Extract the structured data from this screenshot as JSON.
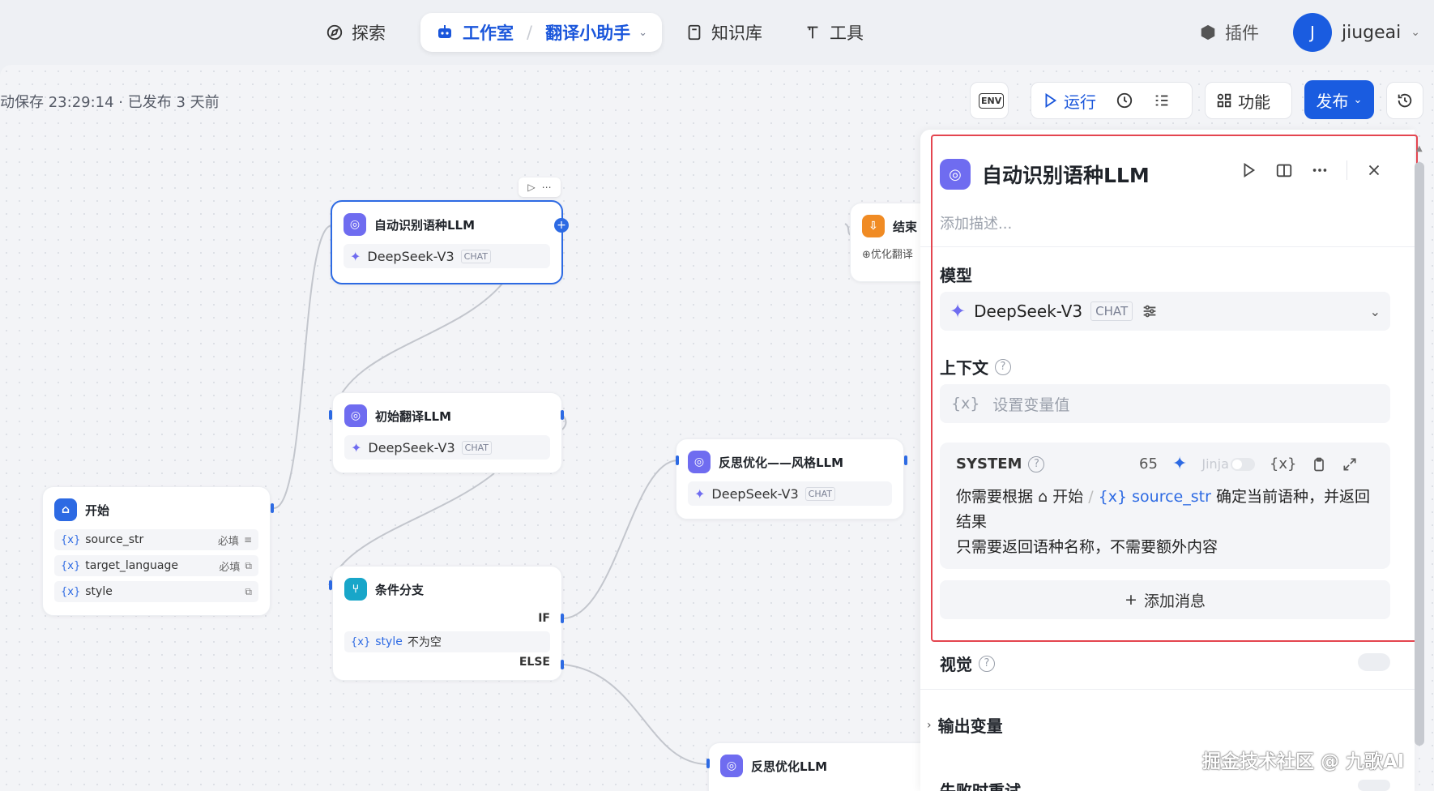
{
  "nav": {
    "explore": "探索",
    "studio": "工作室",
    "project": "翻译小助手",
    "knowledge": "知识库",
    "tools": "工具",
    "plugins": "插件",
    "user_initial": "J",
    "username": "jiugeai"
  },
  "status": {
    "save_status": "动保存 23:29:14 · 已发布 3 天前"
  },
  "toolbar": {
    "env": "ENV",
    "run": "运行",
    "features": "功能",
    "publish": "发布"
  },
  "nodes": {
    "detect": {
      "title": "自动识别语种LLM",
      "model": "DeepSeek-V3",
      "tag": "CHAT"
    },
    "end": {
      "title": "结束",
      "output": "⊕优化翻译"
    },
    "initial": {
      "title": "初始翻译LLM",
      "model": "DeepSeek-V3",
      "tag": "CHAT"
    },
    "reflect_style": {
      "title": "反思优化——风格LLM",
      "model": "DeepSeek-V3",
      "tag": "CHAT"
    },
    "start": {
      "title": "开始",
      "vars": [
        {
          "name": "source_str",
          "required": "必填"
        },
        {
          "name": "target_language",
          "required": "必填"
        },
        {
          "name": "style",
          "required": ""
        }
      ]
    },
    "condition": {
      "title": "条件分支",
      "if_label": "IF",
      "condition_var": "style",
      "condition_op": "不为空",
      "else_label": "ELSE"
    },
    "reflect": {
      "title": "反思优化LLM"
    }
  },
  "panel": {
    "title": "自动识别语种LLM",
    "description_placeholder": "添加描述...",
    "model_label": "模型",
    "model_name": "DeepSeek-V3",
    "model_tag": "CHAT",
    "context_label": "上下文",
    "context_placeholder": "设置变量值",
    "system_label": "SYSTEM",
    "token_count": "65",
    "jinja_label": "Jinja",
    "prompt_prefix": "你需要根据",
    "prompt_ref_node": "开始",
    "prompt_ref_var": "source_str",
    "prompt_suffix": "确定当前语种，并返回结果",
    "prompt_line2": "只需要返回语种名称，不需要额外内容",
    "add_message": "添加消息",
    "vision_label": "视觉",
    "output_vars_label": "输出变量",
    "retry_label": "失败时重试"
  },
  "watermark": "掘金技术社区 @ 九歌AI"
}
